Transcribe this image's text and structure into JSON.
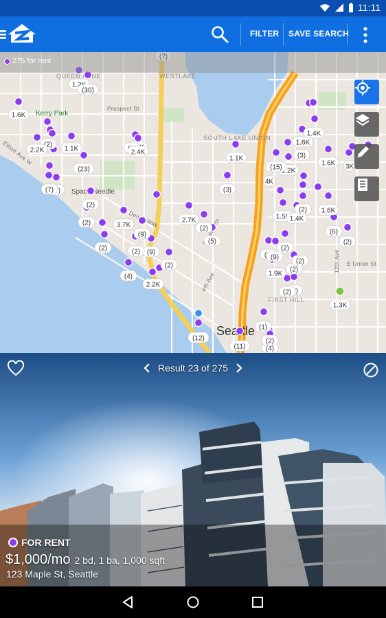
{
  "status_bar": {
    "time": "11:11"
  },
  "action_bar": {
    "filter_label": "FILTER",
    "save_search_label": "SAVE SEARCH"
  },
  "map": {
    "rental_count": "275 for rent",
    "neighborhoods": [
      "QUEEN ANNE",
      "WESTLAKE",
      "SOUTH LAKE UNION",
      "FIRST HILL"
    ],
    "pois": [
      "Kerry Park",
      "Space Needle"
    ],
    "streets": [
      "Prospect St",
      "Elliott Ave W",
      "Denny Way",
      "Stewart St",
      "4th Ave",
      "E Union St",
      "12th Ave"
    ],
    "city": "Seattle",
    "cluster_labels": [
      "(7)",
      "1.2K",
      "(30)",
      "1.6K",
      "(2)",
      "1.8K",
      "(9)",
      "2.2K",
      "1.1K",
      "2.4K",
      "(23)",
      "(7)",
      "(7)",
      "(2)",
      "(2)",
      "(2)",
      "3.7K",
      "(9)",
      "(9)",
      "(2)",
      "(2)",
      "(4)",
      "2.2K",
      "(2)",
      "2.7K",
      "(2)",
      "(5)",
      "1.1K",
      "(3)",
      "(12)",
      "(11)",
      "(4)",
      "(1)",
      "(2)",
      "1.6K",
      "1.4K",
      "1.6K",
      "3K",
      "1.2K",
      "(15)",
      "4K",
      "1.5K",
      "1.4K",
      "(2)",
      "1.6K",
      "(6)",
      "(2)",
      "(2)",
      "(2)",
      "(2)",
      "1.9K",
      "(2)",
      "1.3K",
      "(2)",
      "(2)",
      "(9)",
      "(3)"
    ]
  },
  "listing": {
    "nav_text": "Result 23 of 275",
    "status": "FOR RENT",
    "price": "$1,000/mo",
    "details": "2 bd, 1 ba, 1,000 sqft",
    "address": "123 Maple St, Seattle"
  },
  "colors": {
    "brand_blue": "#0f6fe0",
    "status_bar": "#0a4fb0",
    "marker_purple": "#8b3cf0",
    "freeway_orange": "#f7a21b",
    "freeway_yellow": "#f5cf56",
    "water": "#aaccee"
  },
  "icons": [
    "zillow-logo-icon",
    "search-icon",
    "overflow-menu-icon",
    "my-location-icon",
    "layers-icon",
    "draw-icon",
    "list-icon",
    "heart-icon",
    "chevron-left-icon",
    "chevron-right-icon",
    "hide-icon",
    "back-icon",
    "home-icon",
    "recents-icon"
  ]
}
